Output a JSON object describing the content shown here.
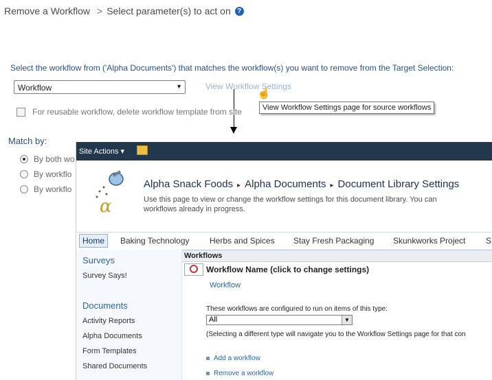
{
  "page": {
    "title": "Remove a Workflow",
    "title_sep": ">",
    "subtitle": "Select parameter(s) to act on",
    "help_glyph": "?"
  },
  "instruction": "Select the workflow from ('Alpha Documents') that matches the workflow(s) you want to remove from the Target Selection:",
  "workflow_select": {
    "value": "Workflow"
  },
  "view_link": "View Workflow Settings",
  "tooltip": "View Workflow Settings page for source workflows",
  "reusable_checkbox": {
    "label": "For reusable workflow, delete workflow template from site",
    "checked": false
  },
  "match": {
    "label": "Match by:",
    "options": [
      {
        "label": "By both wo",
        "checked": true
      },
      {
        "label": "By workflo",
        "checked": false
      },
      {
        "label": "By workflo",
        "checked": false
      }
    ]
  },
  "sharepoint": {
    "site_actions": "Site Actions ▾",
    "breadcrumb": [
      "Alpha Snack Foods",
      "Alpha Documents",
      "Document Library Settings"
    ],
    "breadcrumb_sep": "▸",
    "description_line1": "Use this page to view or change the workflow settings for this document library. You can",
    "description_line2": "workflows already in progress.",
    "tabs": [
      "Home",
      "Baking Technology",
      "Herbs and Spices",
      "Stay Fresh Packaging",
      "Skunkworks Project",
      "S"
    ],
    "nav": {
      "surveys_head": "Surveys",
      "surveys_item": "Survey Says!",
      "documents_head": "Documents",
      "documents_items": [
        "Activity Reports",
        "Alpha Documents",
        "Form Templates",
        "Shared Documents"
      ]
    },
    "workflows_header": "Workflows",
    "workflow_name_title": "Workflow Name (click to change settings)",
    "workflow_link": "Workflow",
    "configured_text": "These workflows are configured to run on items of this type:",
    "type_select": "All",
    "select_note": "(Selecting a different type will navigate you to the Workflow Settings page for that con",
    "actions": [
      "Add a workflow",
      "Remove a workflow"
    ]
  }
}
